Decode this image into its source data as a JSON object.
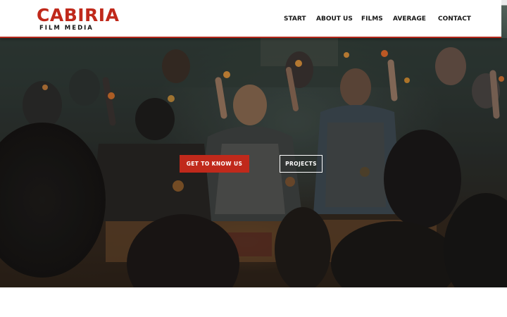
{
  "brand": {
    "name": "CABIRIA",
    "tagline": "FILM MEDIA",
    "accent_color": "#c0291b"
  },
  "nav": {
    "items": [
      {
        "label": "START"
      },
      {
        "label": "ABOUT US"
      },
      {
        "label": "FILMS"
      },
      {
        "label": "AVERAGE"
      },
      {
        "label": "CONTACT"
      }
    ]
  },
  "hero": {
    "image": "group of people in aprons raising snacks in a kitchen",
    "primary_button": "GET TO KNOW US",
    "secondary_button": "PROJECTS"
  }
}
